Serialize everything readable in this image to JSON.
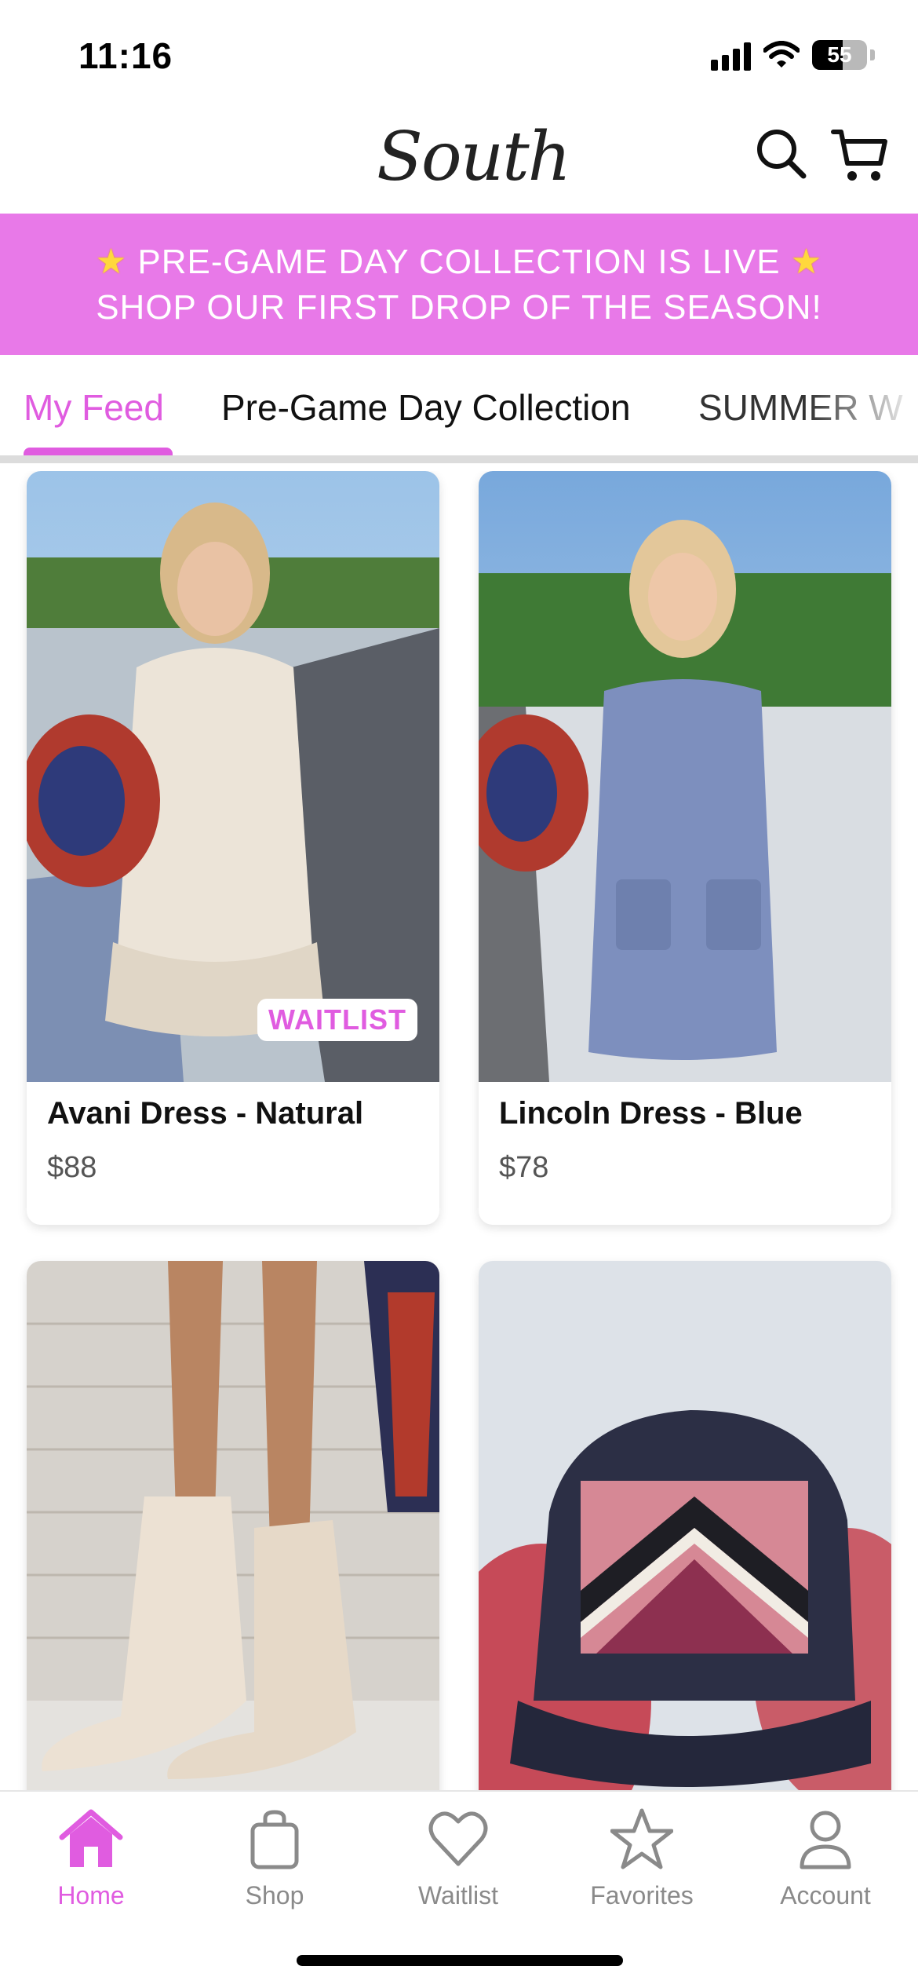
{
  "status_bar": {
    "time": "11:16",
    "battery_level": "55",
    "icons": [
      "signal-icon",
      "wifi-icon",
      "battery-icon"
    ]
  },
  "header": {
    "logo_text": "South",
    "icons": [
      "search-icon",
      "cart-icon"
    ]
  },
  "banner": {
    "line1": "PRE-GAME DAY COLLECTION IS LIVE",
    "line2": "SHOP OUR FIRST DROP OF THE SEASON!",
    "icon": "star-icon"
  },
  "tabs": [
    {
      "label": "My Feed",
      "active": true
    },
    {
      "label": "Pre-Game Day Collection",
      "active": false
    },
    {
      "label": "SUMMER W",
      "active": false
    }
  ],
  "products": [
    {
      "name": "Avani Dress - Natural",
      "price": "$88",
      "badge": "WAITLIST"
    },
    {
      "name": "Lincoln Dress - Blue",
      "price": "$78",
      "badge": ""
    },
    {
      "name": "",
      "price": "",
      "badge": ""
    },
    {
      "name": "",
      "price": "",
      "badge": ""
    }
  ],
  "bottom_nav": [
    {
      "label": "Home",
      "icon": "home-icon",
      "active": true
    },
    {
      "label": "Shop",
      "icon": "shopping-bag-icon",
      "active": false
    },
    {
      "label": "Waitlist",
      "icon": "heart-icon",
      "active": false
    },
    {
      "label": "Favorites",
      "icon": "star-icon",
      "active": false
    },
    {
      "label": "Account",
      "icon": "person-icon",
      "active": false
    }
  ],
  "colors": {
    "accent": "#e05ce0",
    "banner": "#e879e8"
  }
}
